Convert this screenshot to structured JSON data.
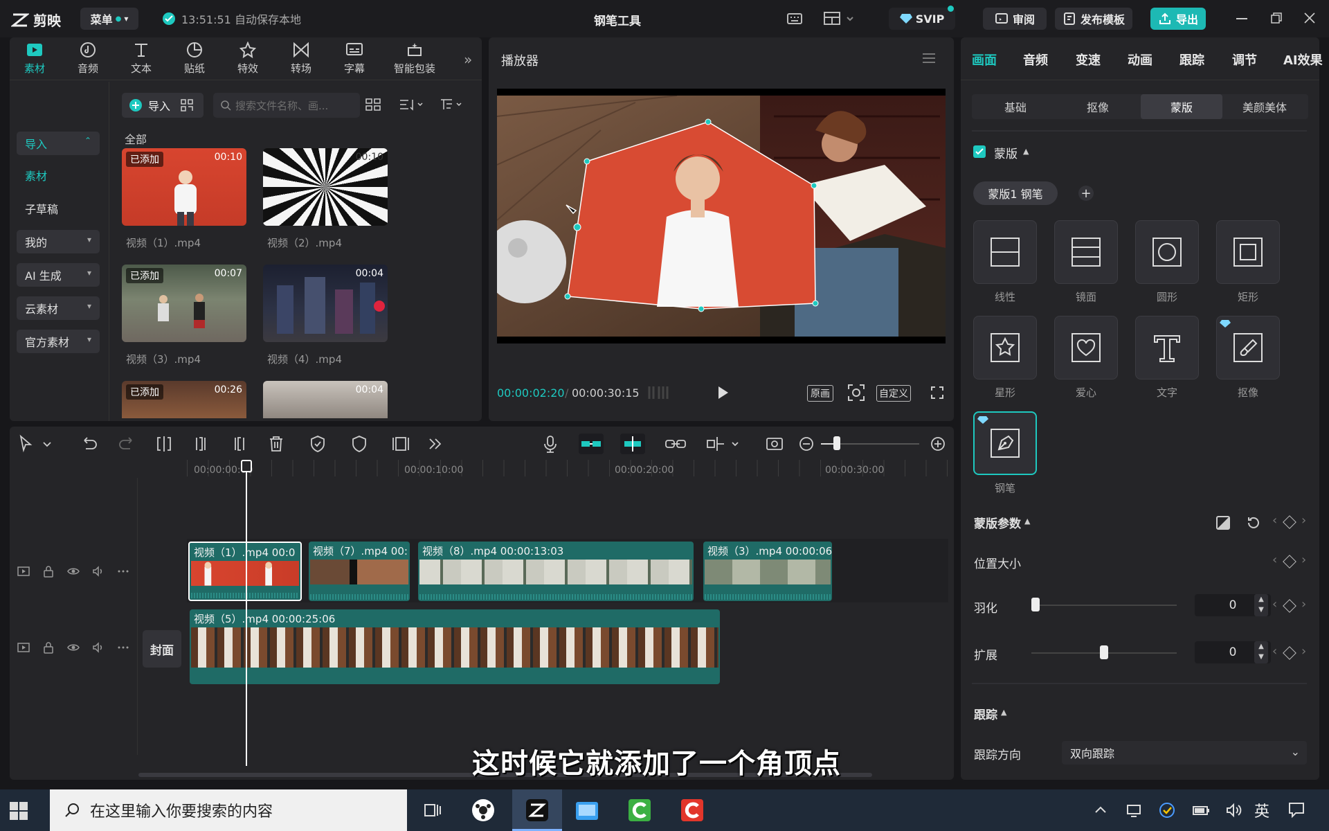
{
  "app": {
    "name": "剪映",
    "menu": "菜单",
    "autosave": "13:51:51 自动保存本地",
    "title": "钢笔工具",
    "svip": "SVIP",
    "review": "审阅",
    "publish_template": "发布模板",
    "export": "导出"
  },
  "media_tabs": [
    {
      "label": "素材",
      "icon": "media-icon"
    },
    {
      "label": "音频",
      "icon": "audio-icon"
    },
    {
      "label": "文本",
      "icon": "text-icon"
    },
    {
      "label": "贴纸",
      "icon": "sticker-icon"
    },
    {
      "label": "特效",
      "icon": "effects-icon"
    },
    {
      "label": "转场",
      "icon": "transition-icon"
    },
    {
      "label": "字幕",
      "icon": "subtitle-icon"
    },
    {
      "label": "智能包装",
      "icon": "smart-pack-icon"
    }
  ],
  "sidebar": {
    "import": "导入",
    "material": "素材",
    "subdraft": "子草稿",
    "mine": "我的",
    "ai": "AI 生成",
    "cloud": "云素材",
    "official": "官方素材"
  },
  "library": {
    "import_btn": "导入",
    "search_placeholder": "搜索文件名称、画...",
    "section": "全部",
    "items": [
      {
        "name": "视频（1）.mp4",
        "duration": "00:10",
        "added": "已添加"
      },
      {
        "name": "视频（2）.mp4",
        "duration": "00:10",
        "added": ""
      },
      {
        "name": "视频（3）.mp4",
        "duration": "00:07",
        "added": "已添加"
      },
      {
        "name": "视频（4）.mp4",
        "duration": "00:04",
        "added": ""
      },
      {
        "name": "",
        "duration": "00:26",
        "added": "已添加"
      },
      {
        "name": "",
        "duration": "00:04",
        "added": ""
      }
    ]
  },
  "player": {
    "title": "播放器",
    "current": "00:00:02:20",
    "total": "00:00:30:15",
    "original": "原画",
    "custom": "自定义"
  },
  "right_panel": {
    "tabs": [
      "画面",
      "音频",
      "变速",
      "动画",
      "跟踪",
      "调节",
      "AI效果"
    ],
    "subtabs": [
      "基础",
      "抠像",
      "蒙版",
      "美颜美体"
    ],
    "mask_section": "蒙版",
    "mask_chip": "蒙版1 钢笔",
    "masks": [
      {
        "label": "线性",
        "icon": "linear-mask-icon"
      },
      {
        "label": "镜面",
        "icon": "mirror-mask-icon"
      },
      {
        "label": "圆形",
        "icon": "circle-mask-icon"
      },
      {
        "label": "矩形",
        "icon": "rect-mask-icon"
      },
      {
        "label": "星形",
        "icon": "star-mask-icon"
      },
      {
        "label": "爱心",
        "icon": "heart-mask-icon"
      },
      {
        "label": "文字",
        "icon": "text-mask-icon"
      },
      {
        "label": "抠像",
        "icon": "brush-mask-icon"
      },
      {
        "label": "钢笔",
        "icon": "pen-mask-icon"
      }
    ],
    "params_title": "蒙版参数",
    "position_size": "位置大小",
    "feather": "羽化",
    "feather_value": "0",
    "feather_level": 0.0,
    "expand": "扩展",
    "expand_value": "0",
    "expand_level": 0.5,
    "tracking_title": "跟踪",
    "tracking_dir_label": "跟踪方向",
    "tracking_dir_value": "双向跟踪"
  },
  "timeline": {
    "ruler": [
      "00:00:00:00",
      "00:00:10:00",
      "00:00:20:00",
      "00:00:30:00"
    ],
    "cover": "封面",
    "track1": [
      {
        "label": "视频（1）.mp4",
        "time": "00:0"
      },
      {
        "label": "视频（7）.mp4",
        "time": "00:"
      },
      {
        "label": "视频（8）.mp4",
        "time": "00:00:13:03"
      },
      {
        "label": "视频（3）.mp4",
        "time": "00:00:06"
      }
    ],
    "track2": [
      {
        "label": "视频（5）.mp4",
        "time": "00:00:25:06"
      }
    ]
  },
  "subtitle": "这时候它就添加了一个角顶点",
  "taskbar": {
    "search_placeholder": "在这里输入你要搜索的内容",
    "ime": "英"
  },
  "colors": {
    "accent": "#1ec9c0",
    "export_bg": "#1db9b4",
    "bg": "#17171a",
    "panel": "#252528",
    "clip": "#1f6b66"
  }
}
